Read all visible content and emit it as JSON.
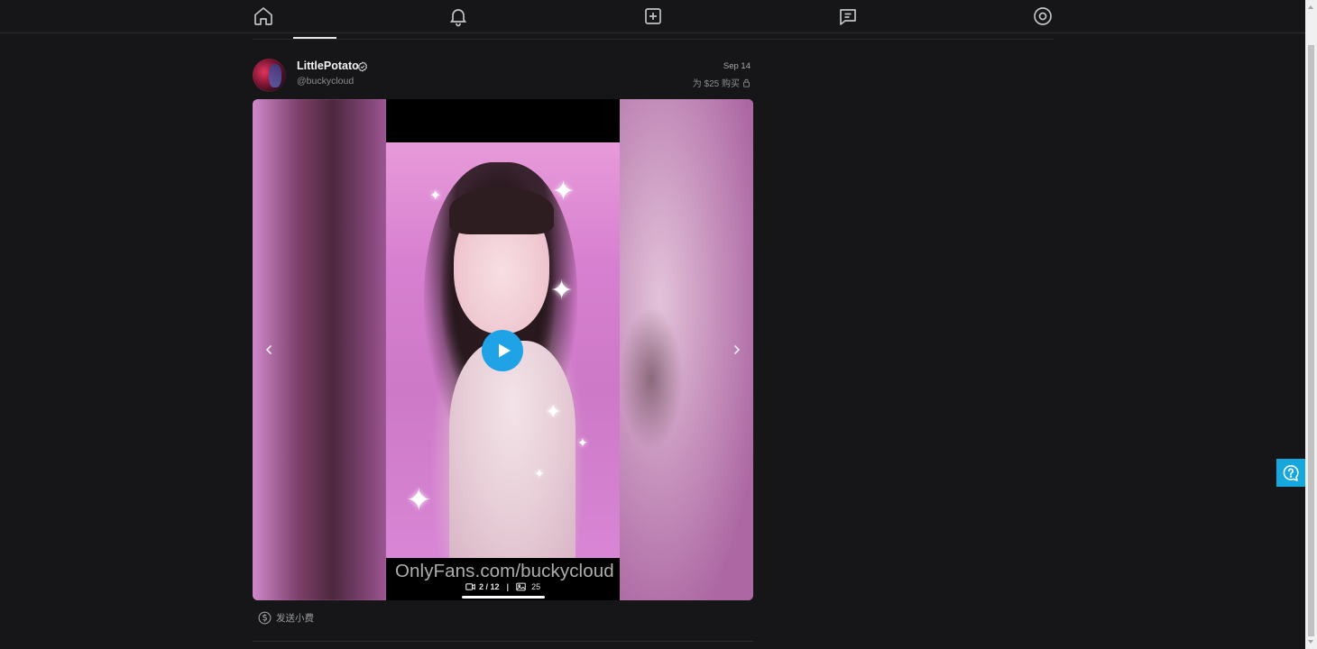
{
  "nav": {
    "items": [
      {
        "name": "home",
        "icon": "home-icon"
      },
      {
        "name": "notifications",
        "icon": "bell-icon"
      },
      {
        "name": "add-post",
        "icon": "plus-square-icon"
      },
      {
        "name": "messages",
        "icon": "message-icon"
      },
      {
        "name": "profile",
        "icon": "user-circle-icon"
      }
    ],
    "active": "home"
  },
  "post": {
    "author_name": "LittlePotato",
    "author_handle": "@buckycloud",
    "verified": true,
    "date": "Sep 14",
    "price_label": "为 $25 购买",
    "media": {
      "watermark": "OnlyFans.com/buckycloud",
      "video_counter": "2 / 12",
      "separator": "|",
      "photo_count": "25",
      "play_icon": "play-icon"
    },
    "tip_label": "发送小费"
  },
  "colors": {
    "background": "#161618",
    "accent": "#1fa3e6",
    "help": "#16a7dc"
  }
}
